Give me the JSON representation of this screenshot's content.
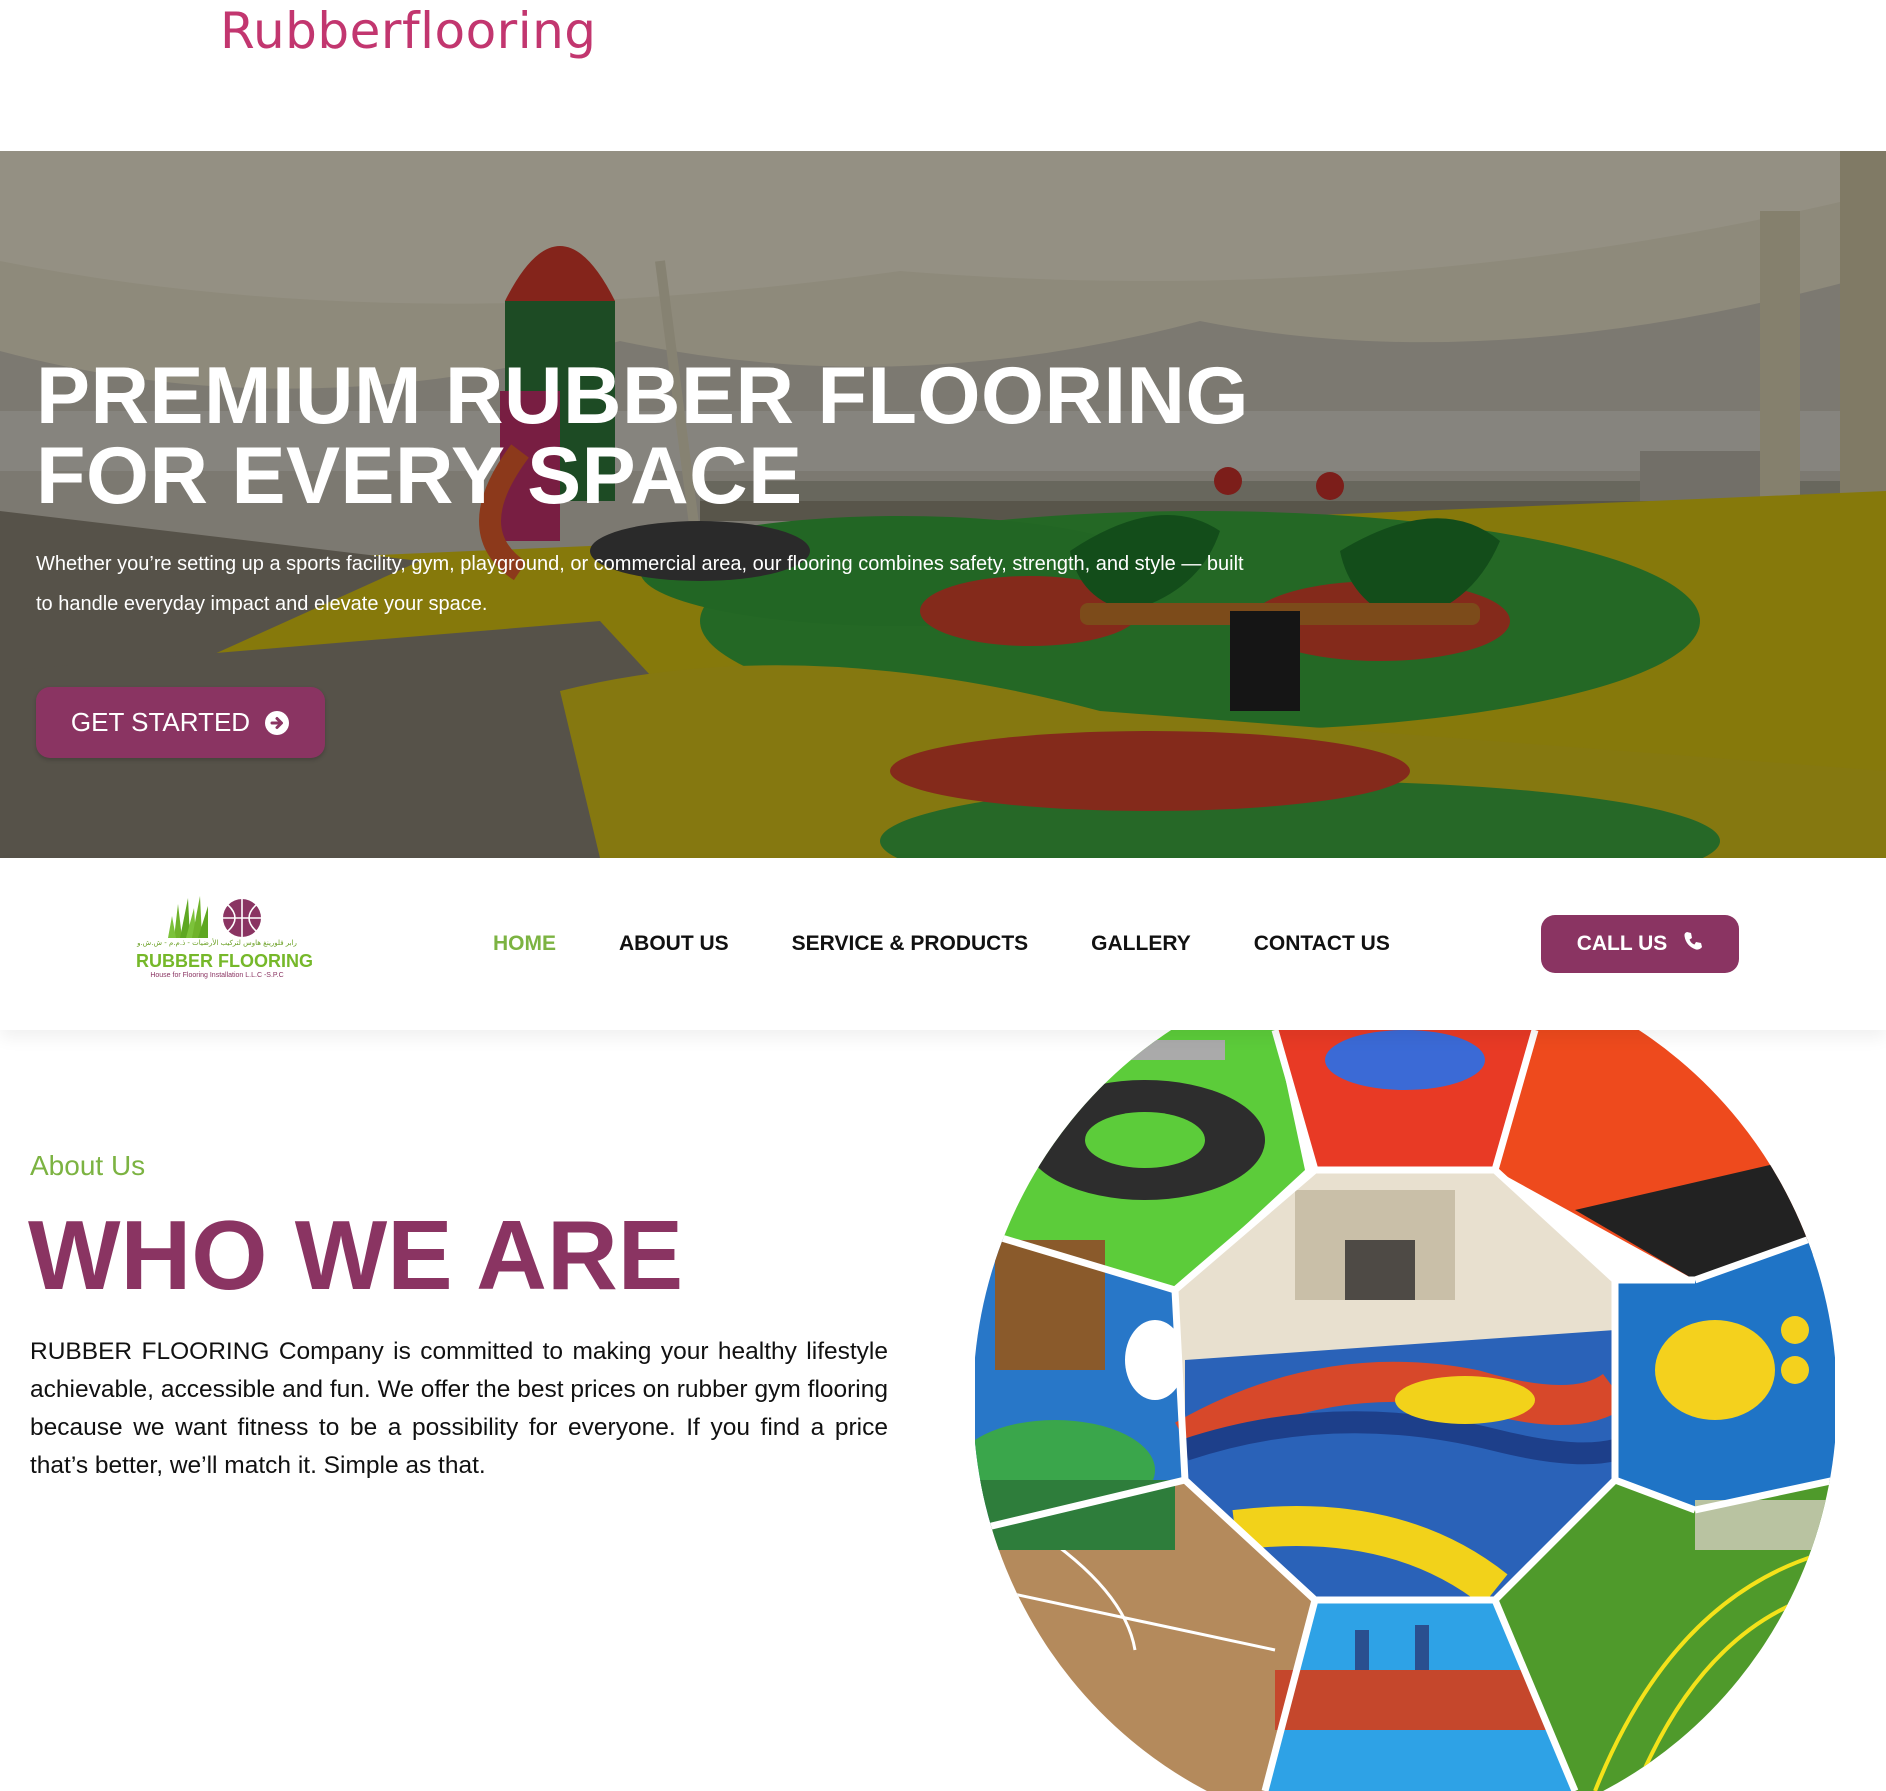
{
  "site": {
    "title": "Rubberflooring"
  },
  "hero": {
    "title_line1": "PREMIUM RUBBER FLOORING",
    "title_line2": "FOR EVERY SPACE",
    "description": "Whether you’re setting up a sports facility, gym, playground, or commercial area, our flooring combines safety, strength, and style — built to handle everyday impact and elevate your space.",
    "cta_label": "GET STARTED",
    "cta_icon": "arrow-circle-right-icon"
  },
  "logo": {
    "name": "RUBBER FLOORING",
    "subtitle": "House for Flooring Installation L.L.C -S.P.C",
    "arabic": "رابر فلورينغ هاوس لتركيب الأرضيات - ذ.م.م - ش.ش.و"
  },
  "nav": {
    "items": [
      {
        "label": "HOME",
        "active": true
      },
      {
        "label": "ABOUT US",
        "active": false
      },
      {
        "label": "SERVICE & PRODUCTS",
        "active": false
      },
      {
        "label": "GALLERY",
        "active": false
      },
      {
        "label": "CONTACT US",
        "active": false
      }
    ],
    "call_label": "CALL US",
    "call_icon": "phone-icon"
  },
  "about": {
    "label": "About Us",
    "heading": "WHO WE ARE",
    "text": "RUBBER FLOORING Company is committed to making your healthy lifestyle achievable, accessible and fun. We offer the best prices on rubber gym flooring because we want fitness to be a possibility for everyone. If you find a price that’s better, we’ll match it. Simple as that."
  },
  "colors": {
    "brand_pink": "#c2366f",
    "brand_purple": "#8a3462",
    "brand_green": "#7cb342"
  }
}
